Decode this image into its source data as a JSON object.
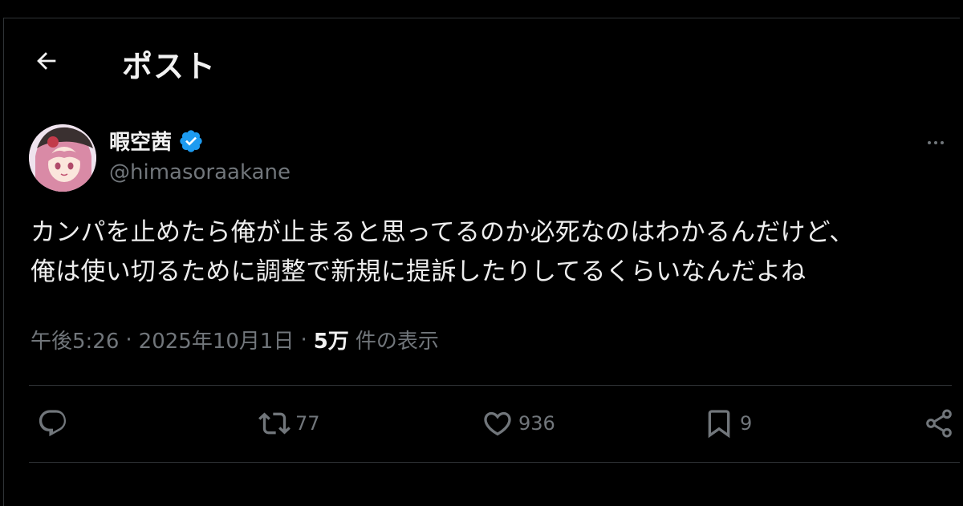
{
  "header": {
    "title": "ポスト",
    "back_icon": "arrow-left-icon"
  },
  "author": {
    "display_name": "暇空茜",
    "handle": "@himasoraakane",
    "verified": true,
    "verified_color": "#1d9bf0"
  },
  "tweet": {
    "lines": [
      "カンパを止めたら俺が止まると思ってるのか必死なのはわかるんだけど、",
      "俺は使い切るために調整で新規に提訴したりしてるくらいなんだよね"
    ]
  },
  "meta": {
    "time": "午後5:26",
    "separator": "·",
    "date": "2025年10月1日",
    "views_count": "5万",
    "views_label": "件の表示"
  },
  "actions": {
    "reply": {
      "icon": "reply-icon",
      "count": ""
    },
    "repost": {
      "icon": "repost-icon",
      "count": "77"
    },
    "like": {
      "icon": "heart-icon",
      "count": "936"
    },
    "bookmark": {
      "icon": "bookmark-icon",
      "count": "9"
    },
    "share": {
      "icon": "share-icon"
    }
  },
  "colors": {
    "background": "#000000",
    "text": "#e7e9ea",
    "muted": "#71767b",
    "border": "#2f3336"
  }
}
